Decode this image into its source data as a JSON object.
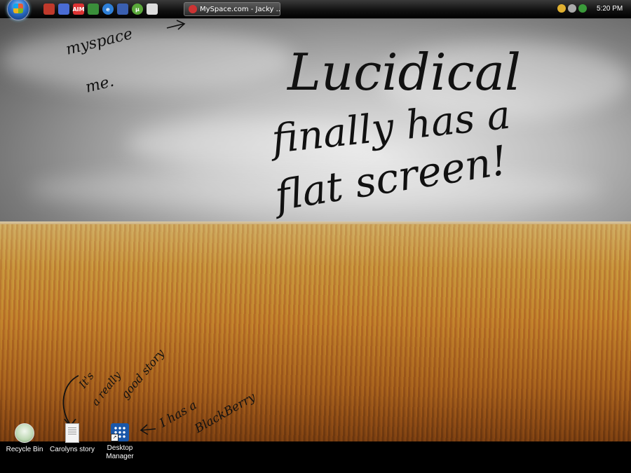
{
  "taskbar": {
    "active_window_title": "MySpace.com - Jacky ...",
    "clock": "5:20 PM",
    "quicklaunch": [
      {
        "icon": "firefox-icon",
        "color": "#c0392b",
        "label": ""
      },
      {
        "icon": "media-icon",
        "color": "#4a6cd4",
        "label": ""
      },
      {
        "icon": "aim-icon",
        "color": "#d33",
        "label": "AIM"
      },
      {
        "icon": "refresh-icon",
        "color": "#3a8f3a",
        "label": ""
      },
      {
        "icon": "internet-explorer-icon",
        "color": "#2d7fd8",
        "label": "e"
      },
      {
        "icon": "play-icon",
        "color": "#3a5fb0",
        "label": ""
      },
      {
        "icon": "utorrent-icon",
        "color": "#5aa83a",
        "label": "µ"
      },
      {
        "icon": "ghost-icon",
        "color": "#ddd",
        "label": ""
      }
    ],
    "tray": [
      {
        "icon": "network-icon",
        "color": "#e0b030"
      },
      {
        "icon": "volume-icon",
        "color": "#aaa"
      },
      {
        "icon": "security-icon",
        "color": "#3a9a3a"
      }
    ]
  },
  "desktop": {
    "icons": [
      {
        "icon": "recycle-bin-icon",
        "label": "Recycle Bin"
      },
      {
        "icon": "text-document-icon",
        "label": "Carolyns story"
      },
      {
        "icon": "blackberry-desktop-manager-icon",
        "label": "Desktop Manager"
      }
    ]
  },
  "handwriting": {
    "myspace_line1": "myspace",
    "myspace_line2": "me.",
    "title": "Lucidical",
    "line2": "finally has a",
    "line3": "flat screen!",
    "story_note_line1": "It's",
    "story_note_line2": "a really",
    "story_note_line3": "good story",
    "blackberry_note_line1": "I has a",
    "blackberry_note_line2": "BlackBerry"
  }
}
